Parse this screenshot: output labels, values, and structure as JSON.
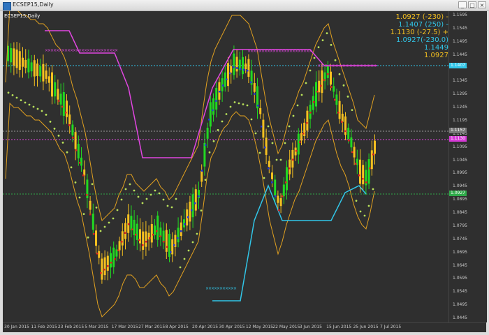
{
  "window": {
    "title": "ECSEP15,Daily",
    "min_button": "_",
    "max_button": "□",
    "close_button": "×"
  },
  "chart": {
    "symbol_label": "ECSEP15,Daily",
    "legend": [
      {
        "text": "1.0927 (-230) -",
        "color": "#f5c020"
      },
      {
        "text": "1.1407 (250) -",
        "color": "#31c6e8"
      },
      {
        "text": "1.1130 (-27.5) +",
        "color": "#f5c020"
      },
      {
        "text": "1.0927(-230.0)",
        "color": "#31c6e8"
      },
      {
        "text": "1.1449",
        "color": "#31c6e8"
      },
      {
        "text": "1.0927",
        "color": "#f5c020"
      }
    ],
    "price_ticks": [
      "1.1595",
      "1.1545",
      "1.1495",
      "1.1445",
      "1.1395",
      "1.1345",
      "1.1295",
      "1.1245",
      "1.1195",
      "1.1145",
      "1.1095",
      "1.1045",
      "1.0995",
      "1.0945",
      "1.0895",
      "1.0845",
      "1.0795",
      "1.0745",
      "1.0695",
      "1.0645",
      "1.0595",
      "1.0545",
      "1.0495",
      "1.0445"
    ],
    "date_ticks": [
      "30 Jan 2015",
      "11 Feb 2015",
      "23 Feb 2015",
      "5 Mar 2015",
      "17 Mar 2015",
      "27 Mar 2015",
      "8 Apr 2015",
      "20 Apr 2015",
      "30 Apr 2015",
      "12 May 2015",
      "22 May 2015",
      "3 Jun 2015",
      "15 Jun 2015",
      "25 Jun 2015",
      "7 Jul 2015"
    ],
    "price_tags": [
      {
        "text": "1.1407",
        "bg": "#31c6e8"
      },
      {
        "text": "1.1157",
        "bg": "#777777"
      },
      {
        "text": "1.1130",
        "bg": "#d63ad6"
      },
      {
        "text": "1.0927",
        "bg": "#2faa4a"
      }
    ],
    "colors": {
      "bull": "#22d822",
      "bear": "#f5c020",
      "upper_channel": "#e046e0",
      "lower_channel": "#31c6e8",
      "envelope": "#e0a020",
      "sar_dots": "#b8e05a",
      "line_up": "#2336d8",
      "line_down": "#e02020",
      "xmarker_pink": "#e046e0",
      "xmarker_cyan": "#31c6e8",
      "hline_cyan": "#31c6e8",
      "hline_gray": "#9a9a9a",
      "hline_pink": "#e046e0",
      "hline_green": "#2faa4a"
    }
  }
}
